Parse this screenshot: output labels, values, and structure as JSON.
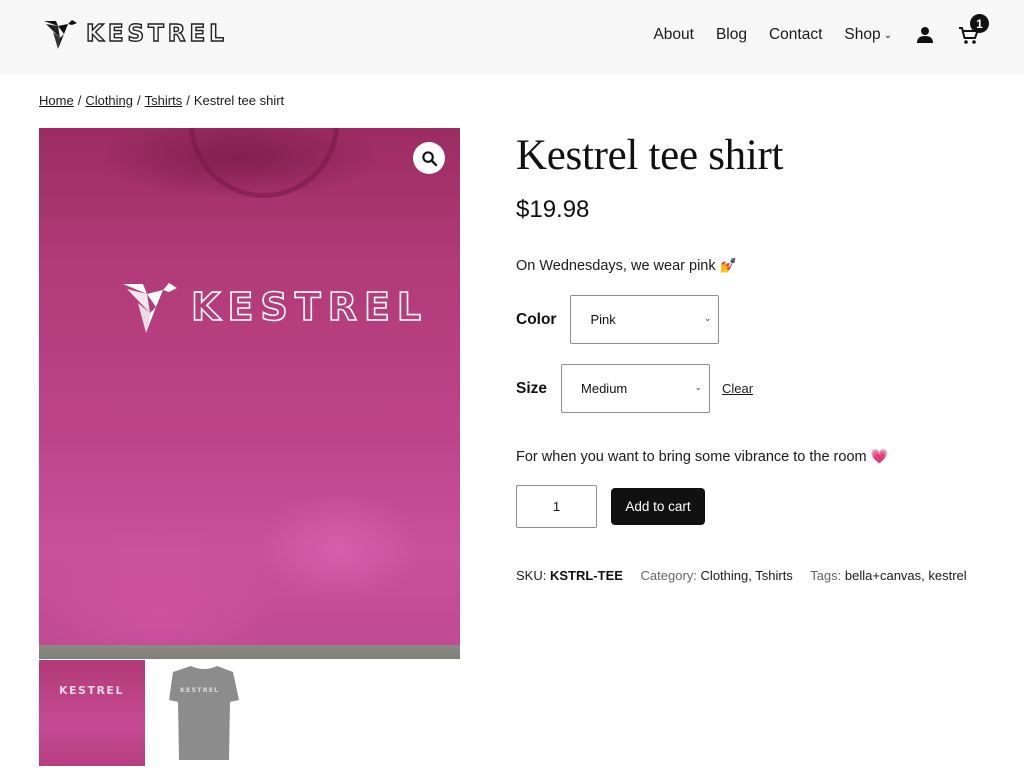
{
  "site": {
    "logo_text": "KESTREL",
    "nav": [
      {
        "label": "About"
      },
      {
        "label": "Blog"
      },
      {
        "label": "Contact"
      },
      {
        "label": "Shop"
      }
    ],
    "shop_chevron": "⌄",
    "cart_count": "1",
    "icons": {
      "logo": "kestrel-bird-logo",
      "account": "user-icon",
      "cart": "cart-icon",
      "zoom": "magnifier-icon",
      "dropdown": "chevron-down-icon"
    }
  },
  "breadcrumb": {
    "items": [
      {
        "label": "Home"
      },
      {
        "label": "Clothing"
      },
      {
        "label": "Tshirts"
      }
    ],
    "separator": "/",
    "current": "Kestrel tee shirt"
  },
  "gallery": {
    "main_print_text": "KESTREL",
    "thumbnails": [
      {
        "alt": "Pink Kestrel tee",
        "print_text": "KESTREL"
      },
      {
        "alt": "Gray Kestrel tee",
        "print_text": "KESTREL"
      }
    ]
  },
  "product": {
    "title": "Kestrel tee shirt",
    "price": "$19.98",
    "short_description": "On Wednesdays, we wear pink",
    "short_description_emoji": "💅",
    "variations": {
      "color": {
        "label": "Color",
        "selected": "Pink"
      },
      "size": {
        "label": "Size",
        "selected": "Medium"
      },
      "clear_label": "Clear"
    },
    "variation_description": "For when you want to bring some vibrance to the room",
    "variation_description_emoji": "💗",
    "quantity": "1",
    "add_to_cart_label": "Add to cart",
    "meta": {
      "sku_label": "SKU:",
      "sku_value": "KSTRL-TEE",
      "category_label": "Category:",
      "categories": [
        "Clothing",
        "Tshirts"
      ],
      "tags_label": "Tags:",
      "tags": [
        "bella+canvas",
        "kestrel"
      ]
    }
  },
  "colors": {
    "header_bg": "#f7f7f7",
    "button_bg": "#111111",
    "shirt_pink": "#b13a78",
    "shirt_gray": "#8c8c8c"
  }
}
